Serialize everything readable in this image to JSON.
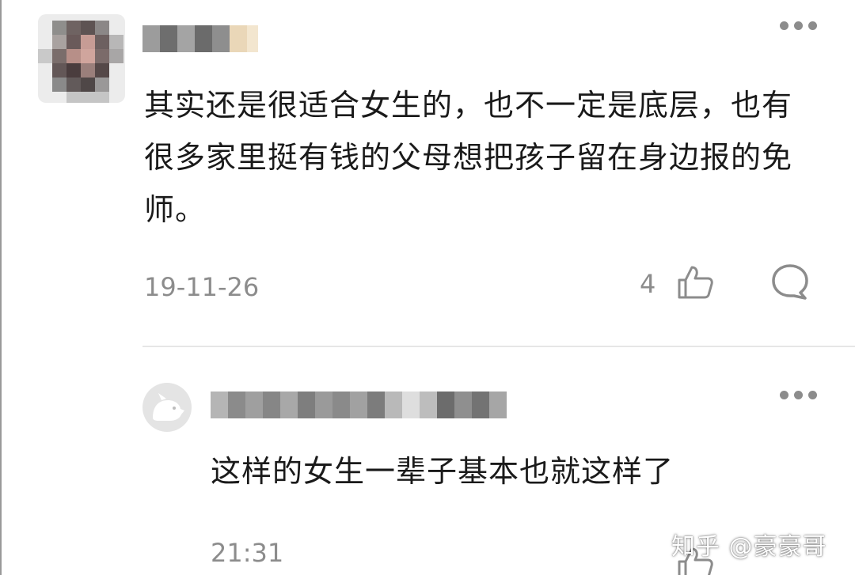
{
  "comment": {
    "text": "其实还是很适合女生的，也不一定是底层，也有很多家里挺有钱的父母想把孩子留在身边报的免师。",
    "timestamp": "19-11-26",
    "like_count": "4"
  },
  "reply": {
    "text": "这样的女生一辈子基本也就这样了",
    "timestamp": "21:31"
  },
  "watermark": "知乎 @豪豪哥",
  "icons": {
    "more": "more-dots-icon",
    "like": "thumbs-up-icon",
    "comment": "comment-bubble-icon",
    "default_avatar": "default-avatar-dog-icon"
  },
  "colors": {
    "text_primary": "#1a1a1a",
    "text_secondary": "#8c8c8c",
    "divider": "#e6e6e6"
  }
}
